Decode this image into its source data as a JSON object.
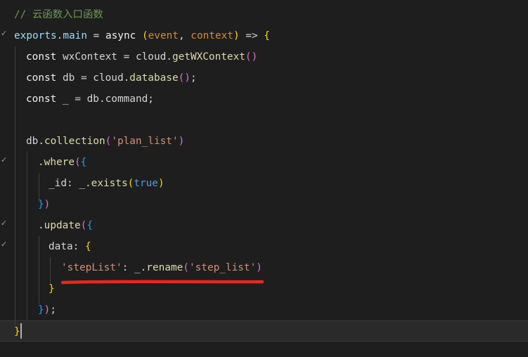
{
  "editor": {
    "lines": [
      {
        "segments": [
          [
            "// 云函数入口函数",
            "cm"
          ]
        ]
      },
      {
        "segments": [
          [
            "exports",
            "pm"
          ],
          [
            ".",
            "vs"
          ],
          [
            "main",
            "pm"
          ],
          [
            " = ",
            "vs"
          ],
          [
            "async",
            "kw"
          ],
          [
            " (",
            "p1"
          ],
          [
            "event",
            "param"
          ],
          [
            ", ",
            "vs"
          ],
          [
            "context",
            "param"
          ],
          [
            ")",
            "p1"
          ],
          [
            " => ",
            "vs"
          ],
          [
            "{",
            "p1"
          ]
        ]
      },
      {
        "segments": [
          [
            "const",
            "kw"
          ],
          [
            " wxContext = cloud.",
            "vs"
          ],
          [
            "getWXContext",
            "fn"
          ],
          [
            "()",
            "p2"
          ]
        ]
      },
      {
        "segments": [
          [
            "const",
            "kw"
          ],
          [
            " db = cloud.",
            "vs"
          ],
          [
            "database",
            "fn"
          ],
          [
            "()",
            "p2"
          ],
          [
            ";",
            "vs"
          ]
        ]
      },
      {
        "segments": [
          [
            "const",
            "kw"
          ],
          [
            " _ = db.command;",
            "vs"
          ]
        ]
      },
      {
        "segments": []
      },
      {
        "segments": [
          [
            "db.",
            "vs"
          ],
          [
            "collection",
            "fn"
          ],
          [
            "(",
            "p2"
          ],
          [
            "'plan_list'",
            "str"
          ],
          [
            ")",
            "p2"
          ]
        ]
      },
      {
        "segments": [
          [
            ".",
            "vs"
          ],
          [
            "where",
            "fn"
          ],
          [
            "(",
            "p2"
          ],
          [
            "{",
            "p3"
          ]
        ]
      },
      {
        "segments": [
          [
            "_id",
            "vs"
          ],
          [
            ": _.",
            "vs"
          ],
          [
            "exists",
            "fn"
          ],
          [
            "(",
            "p1"
          ],
          [
            "true",
            "bool"
          ],
          [
            ")",
            "p1"
          ]
        ]
      },
      {
        "segments": [
          [
            "}",
            "p3"
          ],
          [
            ")",
            "p2"
          ]
        ]
      },
      {
        "segments": [
          [
            ".",
            "vs"
          ],
          [
            "update",
            "fn"
          ],
          [
            "(",
            "p2"
          ],
          [
            "{",
            "p3"
          ]
        ]
      },
      {
        "segments": [
          [
            "data",
            "vs"
          ],
          [
            ": ",
            "vs"
          ],
          [
            "{",
            "p1"
          ]
        ]
      },
      {
        "segments": [
          [
            "'stepList'",
            "str"
          ],
          [
            ": _.",
            "vs"
          ],
          [
            "rename",
            "fn"
          ],
          [
            "(",
            "p2"
          ],
          [
            "'step_list'",
            "str"
          ],
          [
            ")",
            "p2"
          ]
        ]
      },
      {
        "segments": [
          [
            "}",
            "p1"
          ]
        ]
      },
      {
        "segments": [
          [
            "}",
            "p3"
          ],
          [
            ")",
            "p2"
          ],
          [
            ";",
            "vs"
          ]
        ]
      },
      {
        "segments": [
          [
            "}",
            "p1"
          ]
        ]
      }
    ],
    "fold_markers": [
      1,
      7,
      10,
      11
    ],
    "current_line": 15,
    "colors": {
      "cm": "#6a9955",
      "kw": "#f0f0f0",
      "pm": "#9cdcfe",
      "fn": "#dcdcaa",
      "str": "#ce9178",
      "param": "#d58a3a",
      "p1": "#ffd700",
      "p2": "#da70d6",
      "p3": "#179fff",
      "vs": "#d4d4d4",
      "bool": "#569cd6",
      "annotation": "#e8271f",
      "background": "#1e1e1e"
    },
    "icons": {
      "fold": "chevron-fold-icon"
    }
  }
}
